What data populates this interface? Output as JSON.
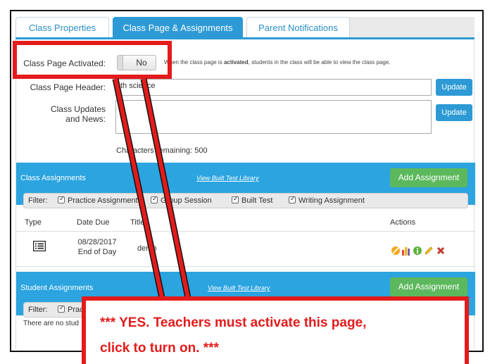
{
  "tabs": [
    {
      "label": "Class Properties",
      "active": false
    },
    {
      "label": "Class Page & Assignments",
      "active": true
    },
    {
      "label": "Parent Notifications",
      "active": false
    }
  ],
  "class_page": {
    "activated_label": "Class Page Activated:",
    "toggle_value": "No",
    "hint_pre": "When the class page is ",
    "hint_bold": "activated",
    "hint_post": ", students in the class will be able to view the class page.",
    "header_label": "Class Page Header:",
    "header_value": "th science",
    "updates_label_1": "Class Updates",
    "updates_label_2": "and News:",
    "updates_value": "",
    "chars_remaining": "Characters remaining: 500",
    "update_label": "Update"
  },
  "class_assignments": {
    "title": "Class Assignments",
    "library_link": "View Built Test Library",
    "add_label": "Add Assignment",
    "filter_label": "Filter:",
    "filters": [
      "Practice Assignment",
      "Group Session",
      "Built Test",
      "Writing Assignment"
    ],
    "columns": [
      "Type",
      "Date Due",
      "Title",
      "Actions"
    ],
    "rows": [
      {
        "date": "08/28/2017",
        "time": "End of Day",
        "title": "demo"
      }
    ]
  },
  "student_assignments": {
    "title": "Student Assignments",
    "library_link": "View Built Test Library",
    "add_label": "Add Assignment",
    "filter_label": "Filter:",
    "filter_first": "Practi",
    "empty_text": "There are no stud"
  },
  "annotation": {
    "line1": "*** YES. Teachers must activate this page,",
    "line2": "click to turn on. ***"
  },
  "colors": {
    "accent": "#2d9ad5",
    "section": "#2ba4df",
    "add_button": "#5cb85c",
    "annotation": "#e31b1b"
  },
  "icons": {
    "type": "list-icon",
    "actions": [
      "prohibit-icon",
      "bar-chart-icon",
      "info-icon",
      "pencil-icon",
      "delete-icon"
    ]
  }
}
